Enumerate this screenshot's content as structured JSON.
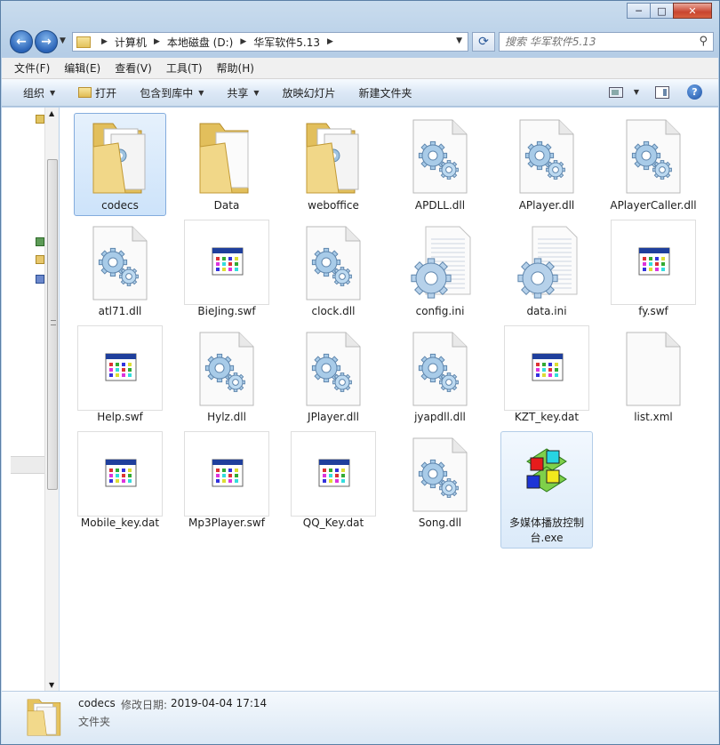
{
  "window": {
    "caption": {
      "minimize": "─",
      "maximize": "□",
      "close": "✕"
    }
  },
  "nav": {
    "back": "←",
    "forward": "→",
    "breadcrumbs": [
      "计算机",
      "本地磁盘 (D:)",
      "华军软件5.13"
    ],
    "refresh": "⟳",
    "search_placeholder": "搜索 华军软件5.13"
  },
  "menu": [
    "文件(F)",
    "编辑(E)",
    "查看(V)",
    "工具(T)",
    "帮助(H)"
  ],
  "toolbar": {
    "organize": "组织",
    "open": "打开",
    "include": "包含到库中",
    "share": "共享",
    "slideshow": "放映幻灯片",
    "new_folder": "新建文件夹",
    "help": "?"
  },
  "files": [
    {
      "name": "codecs",
      "type": "folder-docs"
    },
    {
      "name": "Data",
      "type": "folder-empty"
    },
    {
      "name": "weboffice",
      "type": "folder-docs"
    },
    {
      "name": "APDLL.dll",
      "type": "dll"
    },
    {
      "name": "APlayer.dll",
      "type": "dll"
    },
    {
      "name": "APlayerCaller.dll",
      "type": "dll"
    },
    {
      "name": "atl71.dll",
      "type": "dll"
    },
    {
      "name": "BieJing.swf",
      "type": "app-thumb"
    },
    {
      "name": "clock.dll",
      "type": "dll"
    },
    {
      "name": "config.ini",
      "type": "ini"
    },
    {
      "name": "data.ini",
      "type": "ini"
    },
    {
      "name": "fy.swf",
      "type": "app-thumb"
    },
    {
      "name": "Help.swf",
      "type": "app-thumb"
    },
    {
      "name": "Hylz.dll",
      "type": "dll"
    },
    {
      "name": "JPlayer.dll",
      "type": "dll"
    },
    {
      "name": "jyapdll.dll",
      "type": "dll"
    },
    {
      "name": "KZT_key.dat",
      "type": "app-thumb"
    },
    {
      "name": "list.xml",
      "type": "blank"
    },
    {
      "name": "Mobile_key.dat",
      "type": "app-thumb"
    },
    {
      "name": "Mp3Player.swf",
      "type": "app-thumb"
    },
    {
      "name": "QQ_Key.dat",
      "type": "app-thumb"
    },
    {
      "name": "Song.dll",
      "type": "dll"
    },
    {
      "name": "多媒体播放控制台.exe",
      "type": "exe"
    }
  ],
  "selected_index": 0,
  "hover_index": 22,
  "status": {
    "name": "codecs",
    "date_label": "修改日期:",
    "date": "2019-04-04 17:14",
    "type": "文件夹"
  }
}
